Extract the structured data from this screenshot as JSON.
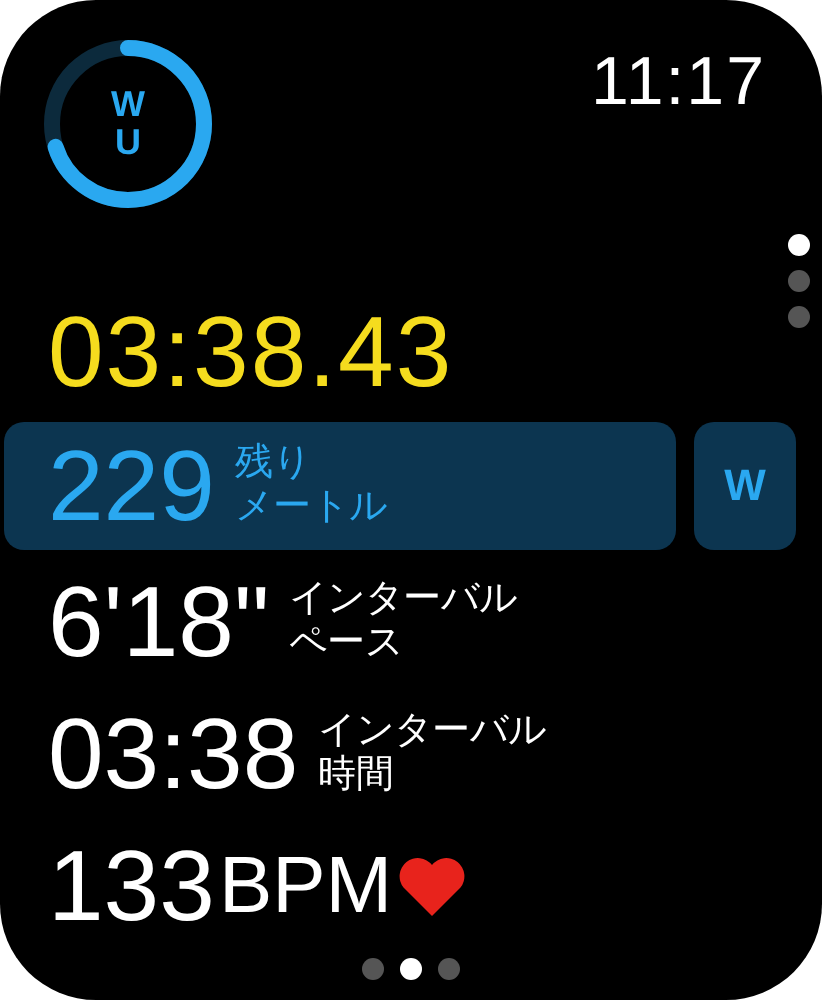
{
  "clock": "11:17",
  "ring": {
    "letters": [
      "W",
      "U"
    ]
  },
  "side_pages": [
    {
      "selected": true
    },
    {
      "selected": false
    },
    {
      "selected": false
    }
  ],
  "elapsed": "03:38.43",
  "remaining": {
    "value": "229",
    "label_lines": [
      "残り",
      "メートル"
    ]
  },
  "segment_button": "W",
  "metrics": [
    {
      "value": "6'18\"",
      "label_lines": [
        "インターバル",
        "ペース"
      ]
    },
    {
      "value": "03:38",
      "label_lines": [
        "インターバル",
        "時間"
      ]
    }
  ],
  "heart_rate": {
    "value": "133",
    "unit": "BPM"
  },
  "page_dots": [
    {
      "selected": false
    },
    {
      "selected": true
    },
    {
      "selected": false
    }
  ]
}
